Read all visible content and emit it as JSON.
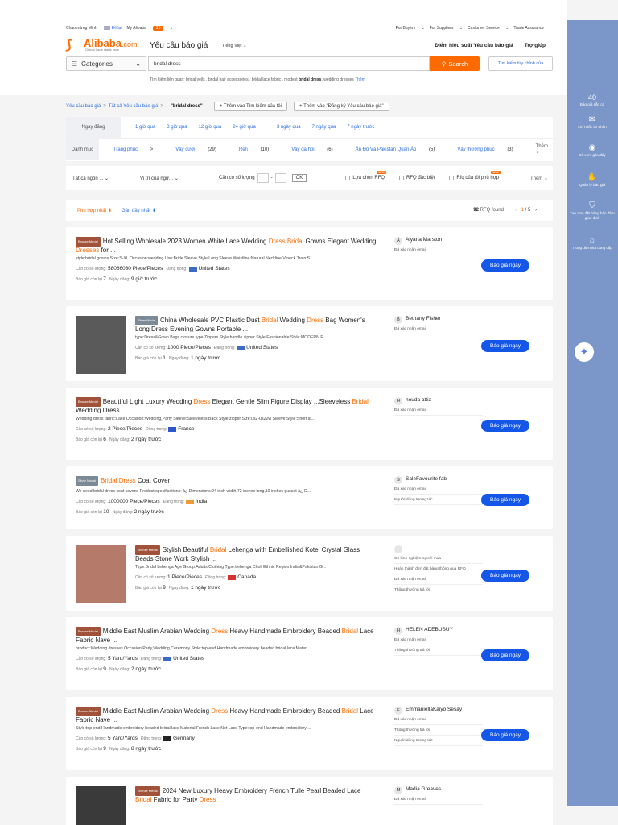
{
  "topbar": {
    "greeting": "Chào mừng Minh",
    "logout": "Đề lại",
    "my_alibaba": "My Alibaba",
    "my_alibaba_badge": "15",
    "for_buyers": "For Buyers",
    "for_suppliers": "For Suppliers",
    "customer_service": "Customer Service",
    "trade_assurance": "Trade Assurance"
  },
  "header": {
    "logo_main": "Alibaba",
    "logo_suffix": ".com",
    "logo_tagline": "Global trade starts here.",
    "page_title": "Yêu cầu báo giá",
    "language": "Tiếng Việt",
    "rfq_score": "Điểm hiệu suất Yêu cầu báo giá",
    "help": "Trợ giúp"
  },
  "search": {
    "category_label": "Categories",
    "value": "bridal dress",
    "button_label": "Search",
    "custom_button": "Tìm kiếm tùy chỉnh của",
    "related_label": "Tìm kiếm liên quan:",
    "related_terms": "bridal veils , bridal hair accessories , bridal lace fabric , modest",
    "related_bold": "bridal dress",
    "related_tail": ", wedding dresses",
    "related_more": "Thêm"
  },
  "breadcrumb": {
    "root": "Yêu cầu báo giá",
    "all": "Tất cả Yêu cầu báo giá",
    "current": "\"bridal dress\"",
    "add_search": "Thêm vào Tìm kiếm của tôi",
    "add_subscribe": "Thêm vào \"Đăng ký Yêu cầu báo giá\""
  },
  "filters": {
    "date_label": "Ngày đăng",
    "dates": [
      "1 giờ qua",
      "3 giờ qua",
      "12 giờ qua",
      "24 giờ qua",
      "3 ngày qua",
      "7 ngày qua",
      "7 ngày trước"
    ],
    "category_label": "Danh mục",
    "categories": [
      {
        "name": "Trang phục",
        "count": ">"
      },
      {
        "name": "Váy cưới",
        "count": "(29)"
      },
      {
        "name": "Ren",
        "count": "(10)"
      },
      {
        "name": "Váy dạ hội",
        "count": "(6)"
      },
      {
        "name": "Ấn Độ Và Pakistan Quần Áo",
        "count": "(5)"
      },
      {
        "name": "Váy thường phục",
        "count": "(3)"
      }
    ],
    "more": "Thêm"
  },
  "filter2": {
    "language": "Tất cả ngôn ...",
    "location": "Vị trí của ngư...",
    "qty_label": "Cần có số lượng",
    "qty_sep": "-",
    "ok": "OK",
    "check1": "Lựa chọn RFQ",
    "check2": "RFQ đặc biệt",
    "check3": "Rfq của tôi phù hợp",
    "new_badge": "NEW",
    "more": "Thêm"
  },
  "sort": {
    "best_match": "Phù hợp nhất",
    "newest": "Gần đây nhất",
    "found_count": "92",
    "found_label": "RFQ found",
    "page_current": "1",
    "page_total": "/ 5"
  },
  "labels": {
    "qty": "Cần có số lượng:",
    "posted_in": "Đăng trong:",
    "quotes_left": "Báo giá còn lại",
    "date": "Ngày đăng:",
    "quote_btn": "Báo giá ngay"
  },
  "rfqs": [
    {
      "medal": "Bronze Medal",
      "t1": "Hot Selling Wholesale 2023 Women White Lace Wedding ",
      "h1": "Dress Bridal",
      "t2": " Gowns Elegant Wedding ",
      "h2": "Dresses",
      "t3": " for ...",
      "desc": "style:bridal gowns Size:S-XL Occasion:wedding Use:Bride Sleeve Style:Long Sleeve Waistline:Natural Neckline:V-neck Train:S...",
      "qty": "58066060 Piece/Pieces",
      "country": "United States",
      "left": "7",
      "date": "9 giờ trước",
      "buyer_initial": "A",
      "buyer": "Aiyana Marston",
      "tags": [
        "Đã xác nhận email"
      ]
    },
    {
      "medal": "Silver Medal",
      "t1": "China Wholesale PVC Plastic Dust ",
      "h1": "Bridal",
      "t2": " Wedding ",
      "h2": "Dress",
      "t3": " Bag Women's Long Dress Evening Gowns Portable ...",
      "desc": "type:Dress&Gown Bags closure type:Zippers Style:handle zipper Style:Fashionable Style:MODERN F...",
      "qty": "1000 Piece/Pieces",
      "country": "United States",
      "left": "1",
      "date": "1 ngày trước",
      "buyer_initial": "B",
      "buyer": "Bethany Fisher",
      "tags": [
        "Đã xác nhận email"
      ]
    },
    {
      "medal": "Bronze Medal",
      "t1": "Beautiful Light Luxury Wedding ",
      "h1": "Dress",
      "t2": " Elegant Gentle Slim Figure Display ...Sleeveless ",
      "h2": "Bridal",
      "t3": " Wedding Dress",
      "desc": "Wedding dress fabric:Lace Occasion:Wedding,Party Sleeve:Sleeveless Back Style:zipper Size:us2-us22w Sleeve Style:Short sl...",
      "qty": "2 Piece/Pieces",
      "country": "France",
      "left": "6",
      "date": "2 ngày trước",
      "buyer_initial": "H",
      "buyer": "houda attia",
      "tags": [
        "Đã xác nhận email"
      ]
    },
    {
      "medal": "Silver Medal",
      "t1": "",
      "h1": "Bridal Dress",
      "t2": " Coat Cover",
      "h2": "",
      "t3": "",
      "desc": "We need bridal dress coat covers. Product specifications: â¿ Dimensions:24 inch width,72 inches long,10 inches gusset â¿ G...",
      "qty": "1000000 Piece/Pieces",
      "country": "India",
      "left": "10",
      "date": "2 ngày trước",
      "buyer_initial": "S",
      "buyer": "SaleFavourite fab",
      "tags": [
        "Đã xác nhận email",
        "Người dùng tương tác"
      ]
    },
    {
      "medal": "Bronze Medal",
      "t1": "Stylish Beautiful ",
      "h1": "Bridal",
      "t2": " Lehenga with Embellished Kotei Crystal Glass Beads Stone Work Stylish ...",
      "h2": "",
      "t3": "",
      "desc": "Type:Bridal Lehenga Age Group:Adults Clothing Type:Lehenga Choli Ethnic Region:India&Pakistan G...",
      "qty": "1 Piece/Pieces",
      "country": "Canada",
      "left": "9",
      "date": "1 ngày trước",
      "buyer_initial": "",
      "buyer": "",
      "tags": [
        "Có kinh nghiệm người mua",
        "Hoàn thành đơn đặt hàng thông qua RFQ",
        "Đã xác nhận email",
        "Thông thường trả lời"
      ]
    },
    {
      "medal": "Bronze Medal",
      "t1": "Middle East Muslim Arabian Wedding ",
      "h1": "Dress",
      "t2": " Heavy Handmade Embroidery Beaded ",
      "h2": "Bridal",
      "t3": " Lace Fabric Nave ...",
      "desc": "product:Wedding dresses Occasion:Party,Wedding,Ceremony Style:top-end Handmade embroidery beaded bridal lace Materi...",
      "qty": "5 Yard/Yards",
      "country": "United States",
      "left": "9",
      "date": "2 ngày trước",
      "buyer_initial": "H",
      "buyer": "HELEN ADEBUSUY I",
      "tags": [
        "Đã xác nhận email",
        "Thông thường trả lời"
      ]
    },
    {
      "medal": "Bronze Medal",
      "t1": "Middle East Muslim Arabian Wedding ",
      "h1": "Dress",
      "t2": " Heavy Handmade Embroidery Beaded ",
      "h2": "Bridal",
      "t3": " Lace Fabric Nave ...",
      "desc": "Style:top-end Handmade embroidery beaded bridal lace Material:French Lace.Net Lace Type:top-end Handmade embroidery ...",
      "qty": "5 Yard/Yards",
      "country": "Germany",
      "left": "9",
      "date": "8 ngày trước",
      "buyer_initial": "E",
      "buyer": "EmmaniellaKaiyo Sesay",
      "tags": [
        "Đã xác nhận email",
        "Thông thường trả lời",
        "Người dùng tương tác"
      ]
    },
    {
      "medal": "Bronze Medal",
      "t1": "2024 New Luxury Heavy Embroidery French Tulle Pearl Beaded Lace ",
      "h1": "Bridal",
      "t2": " Fabric for Party ",
      "h2": "Dress",
      "t3": "",
      "desc": "",
      "qty": "",
      "country": "",
      "left": "",
      "date": "",
      "buyer_initial": "M",
      "buyer": "Madia Greaves",
      "tags": [
        "Đã xác nhận email"
      ]
    }
  ],
  "sidebar": {
    "count": "40",
    "quotes_available": "Báo giá sẵn có",
    "reminders": "Lời nhắc tin nhắn",
    "viewed": "Đã xem gần đây",
    "manage_quotes": "Quản lý báo giá",
    "create_order": "Tạo đơn đặt hàng bảo đảm giao dịch",
    "supplier_center": "Trung tâm nhà cung cấp"
  }
}
